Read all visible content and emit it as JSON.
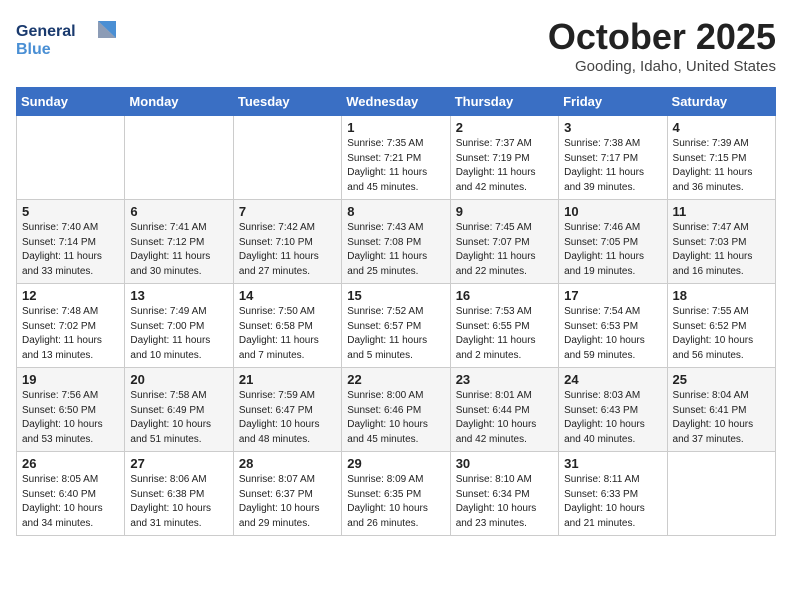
{
  "logo": {
    "line1": "General",
    "line2": "Blue"
  },
  "title": "October 2025",
  "location": "Gooding, Idaho, United States",
  "weekdays": [
    "Sunday",
    "Monday",
    "Tuesday",
    "Wednesday",
    "Thursday",
    "Friday",
    "Saturday"
  ],
  "weeks": [
    [
      {
        "day": "",
        "info": ""
      },
      {
        "day": "",
        "info": ""
      },
      {
        "day": "",
        "info": ""
      },
      {
        "day": "1",
        "info": "Sunrise: 7:35 AM\nSunset: 7:21 PM\nDaylight: 11 hours and 45 minutes."
      },
      {
        "day": "2",
        "info": "Sunrise: 7:37 AM\nSunset: 7:19 PM\nDaylight: 11 hours and 42 minutes."
      },
      {
        "day": "3",
        "info": "Sunrise: 7:38 AM\nSunset: 7:17 PM\nDaylight: 11 hours and 39 minutes."
      },
      {
        "day": "4",
        "info": "Sunrise: 7:39 AM\nSunset: 7:15 PM\nDaylight: 11 hours and 36 minutes."
      }
    ],
    [
      {
        "day": "5",
        "info": "Sunrise: 7:40 AM\nSunset: 7:14 PM\nDaylight: 11 hours and 33 minutes."
      },
      {
        "day": "6",
        "info": "Sunrise: 7:41 AM\nSunset: 7:12 PM\nDaylight: 11 hours and 30 minutes."
      },
      {
        "day": "7",
        "info": "Sunrise: 7:42 AM\nSunset: 7:10 PM\nDaylight: 11 hours and 27 minutes."
      },
      {
        "day": "8",
        "info": "Sunrise: 7:43 AM\nSunset: 7:08 PM\nDaylight: 11 hours and 25 minutes."
      },
      {
        "day": "9",
        "info": "Sunrise: 7:45 AM\nSunset: 7:07 PM\nDaylight: 11 hours and 22 minutes."
      },
      {
        "day": "10",
        "info": "Sunrise: 7:46 AM\nSunset: 7:05 PM\nDaylight: 11 hours and 19 minutes."
      },
      {
        "day": "11",
        "info": "Sunrise: 7:47 AM\nSunset: 7:03 PM\nDaylight: 11 hours and 16 minutes."
      }
    ],
    [
      {
        "day": "12",
        "info": "Sunrise: 7:48 AM\nSunset: 7:02 PM\nDaylight: 11 hours and 13 minutes."
      },
      {
        "day": "13",
        "info": "Sunrise: 7:49 AM\nSunset: 7:00 PM\nDaylight: 11 hours and 10 minutes."
      },
      {
        "day": "14",
        "info": "Sunrise: 7:50 AM\nSunset: 6:58 PM\nDaylight: 11 hours and 7 minutes."
      },
      {
        "day": "15",
        "info": "Sunrise: 7:52 AM\nSunset: 6:57 PM\nDaylight: 11 hours and 5 minutes."
      },
      {
        "day": "16",
        "info": "Sunrise: 7:53 AM\nSunset: 6:55 PM\nDaylight: 11 hours and 2 minutes."
      },
      {
        "day": "17",
        "info": "Sunrise: 7:54 AM\nSunset: 6:53 PM\nDaylight: 10 hours and 59 minutes."
      },
      {
        "day": "18",
        "info": "Sunrise: 7:55 AM\nSunset: 6:52 PM\nDaylight: 10 hours and 56 minutes."
      }
    ],
    [
      {
        "day": "19",
        "info": "Sunrise: 7:56 AM\nSunset: 6:50 PM\nDaylight: 10 hours and 53 minutes."
      },
      {
        "day": "20",
        "info": "Sunrise: 7:58 AM\nSunset: 6:49 PM\nDaylight: 10 hours and 51 minutes."
      },
      {
        "day": "21",
        "info": "Sunrise: 7:59 AM\nSunset: 6:47 PM\nDaylight: 10 hours and 48 minutes."
      },
      {
        "day": "22",
        "info": "Sunrise: 8:00 AM\nSunset: 6:46 PM\nDaylight: 10 hours and 45 minutes."
      },
      {
        "day": "23",
        "info": "Sunrise: 8:01 AM\nSunset: 6:44 PM\nDaylight: 10 hours and 42 minutes."
      },
      {
        "day": "24",
        "info": "Sunrise: 8:03 AM\nSunset: 6:43 PM\nDaylight: 10 hours and 40 minutes."
      },
      {
        "day": "25",
        "info": "Sunrise: 8:04 AM\nSunset: 6:41 PM\nDaylight: 10 hours and 37 minutes."
      }
    ],
    [
      {
        "day": "26",
        "info": "Sunrise: 8:05 AM\nSunset: 6:40 PM\nDaylight: 10 hours and 34 minutes."
      },
      {
        "day": "27",
        "info": "Sunrise: 8:06 AM\nSunset: 6:38 PM\nDaylight: 10 hours and 31 minutes."
      },
      {
        "day": "28",
        "info": "Sunrise: 8:07 AM\nSunset: 6:37 PM\nDaylight: 10 hours and 29 minutes."
      },
      {
        "day": "29",
        "info": "Sunrise: 8:09 AM\nSunset: 6:35 PM\nDaylight: 10 hours and 26 minutes."
      },
      {
        "day": "30",
        "info": "Sunrise: 8:10 AM\nSunset: 6:34 PM\nDaylight: 10 hours and 23 minutes."
      },
      {
        "day": "31",
        "info": "Sunrise: 8:11 AM\nSunset: 6:33 PM\nDaylight: 10 hours and 21 minutes."
      },
      {
        "day": "",
        "info": ""
      }
    ]
  ]
}
